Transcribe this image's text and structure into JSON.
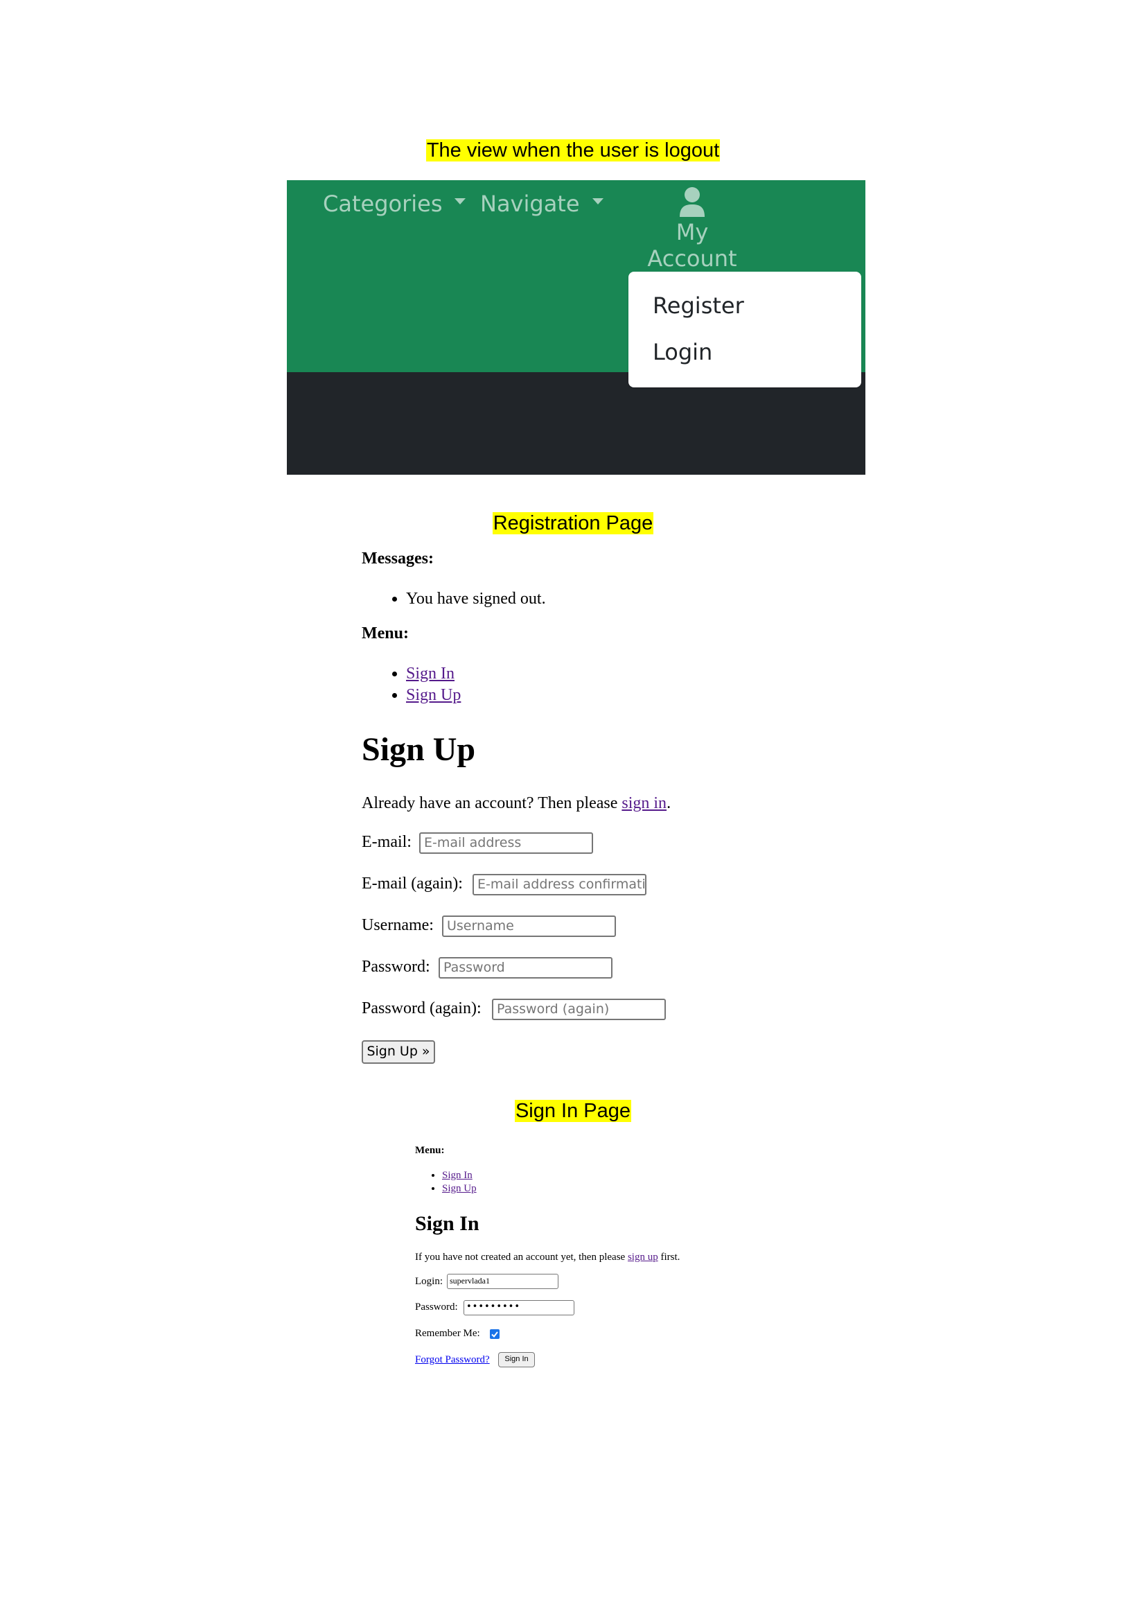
{
  "captions": {
    "logout_view": "The view when the user is logout",
    "registration": "Registration Page",
    "sign_in": "Sign In Page"
  },
  "navbar": {
    "categories": "Categories",
    "navigate": "Navigate",
    "account": "My Account",
    "account_icon": "user-icon",
    "dropdown_items": [
      "Register",
      "Login"
    ],
    "colors": {
      "navbar": "#198754",
      "dark": "#212529"
    }
  },
  "registration": {
    "messages_heading": "Messages:",
    "messages": [
      "You have signed out."
    ],
    "menu_heading": "Menu:",
    "menu_items": [
      "Sign In",
      "Sign Up"
    ],
    "title": "Sign Up",
    "intro_text": "Already have an account? Then please ",
    "intro_link": "sign in",
    "intro_end": ".",
    "fields": [
      {
        "label": "E-mail:",
        "placeholder": "E-mail address"
      },
      {
        "label": "E-mail (again):",
        "placeholder": "E-mail address confirmatic"
      },
      {
        "label": "Username:",
        "placeholder": "Username"
      },
      {
        "label": "Password:",
        "placeholder": "Password"
      },
      {
        "label": "Password (again):",
        "placeholder": "Password (again)"
      }
    ],
    "submit": "Sign Up »"
  },
  "signin": {
    "menu_heading": "Menu:",
    "menu_items": [
      "Sign In",
      "Sign Up"
    ],
    "title": "Sign In",
    "intro_text": "If you have not created an account yet, then please ",
    "intro_link": "sign up",
    "intro_end": " first.",
    "login_label": "Login:",
    "login_value": "supervlada1",
    "password_label": "Password:",
    "password_value": "•••••••••",
    "remember_label": "Remember Me:",
    "remember_checked": true,
    "forgot_link": "Forgot Password?",
    "submit": "Sign In"
  }
}
